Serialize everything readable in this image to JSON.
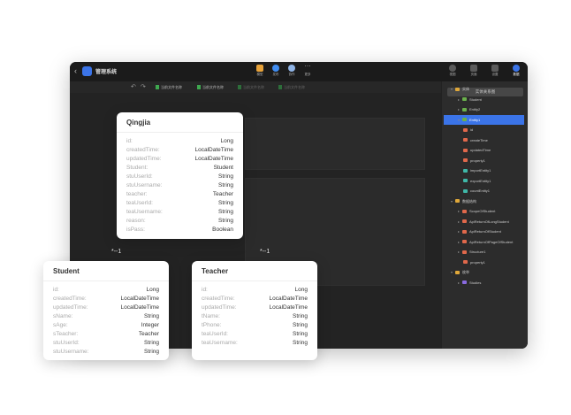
{
  "app": {
    "back": "‹",
    "title": "管理系统"
  },
  "toolbar": [
    {
      "label": "模型",
      "icon": "model-icon",
      "color": "#e8a33a"
    },
    {
      "label": "发布",
      "icon": "cloud-icon",
      "color": "#3f8cf0"
    },
    {
      "label": "协作",
      "icon": "collab-icon",
      "color": "#8fb4e6"
    },
    {
      "label": "更多",
      "icon": "more-icon",
      "color": "#9a9a9a"
    }
  ],
  "right_toolbar": [
    {
      "label": "视图",
      "icon": "view-icon"
    },
    {
      "label": "页面",
      "icon": "page-icon"
    },
    {
      "label": "设置",
      "icon": "settings-icon"
    },
    {
      "label": "数据",
      "icon": "data-icon"
    }
  ],
  "subbar": {
    "undo": "↶",
    "redo": "↷",
    "tabs": [
      "当前文件名称",
      "当前文件名称",
      "当前文件名称",
      "当前文件名称"
    ]
  },
  "right_panel": {
    "button": "实体关系图",
    "tree": [
      {
        "label": "实体",
        "icon": "folder-icon",
        "type": "folder",
        "expanded": true
      },
      {
        "label": "Student",
        "icon": "entity-icon",
        "type": "entity"
      },
      {
        "label": "Entity2",
        "icon": "entity-icon",
        "type": "entity"
      },
      {
        "label": "Entity1",
        "icon": "entity-icon",
        "type": "entity",
        "selected": true
      },
      {
        "label": "id",
        "icon": "field-icon",
        "type": "field"
      },
      {
        "label": "createTime",
        "icon": "field-icon",
        "type": "field"
      },
      {
        "label": "updatedTime",
        "icon": "field-icon",
        "type": "field"
      },
      {
        "label": "property1",
        "icon": "field-icon",
        "type": "field"
      },
      {
        "label": "importEntity1",
        "icon": "logic-icon",
        "type": "logic"
      },
      {
        "label": "exportEntity1",
        "icon": "logic-icon",
        "type": "logic"
      },
      {
        "label": "countEntity1",
        "icon": "logic-icon",
        "type": "logic"
      },
      {
        "label": "数据结构",
        "icon": "folder-icon",
        "type": "folder",
        "expanded": true
      },
      {
        "label": "ScopeOfStudent",
        "icon": "struct-icon",
        "type": "struct"
      },
      {
        "label": "ApiReturnOfLongStudent",
        "icon": "struct-icon",
        "type": "struct"
      },
      {
        "label": "ApiReturnOfStudent",
        "icon": "struct-icon",
        "type": "struct"
      },
      {
        "label": "ApiReturnOfPageOfStudent",
        "icon": "struct-icon",
        "type": "struct"
      },
      {
        "label": "Structure1",
        "icon": "struct-icon",
        "type": "struct"
      },
      {
        "label": "property1",
        "icon": "field-icon",
        "type": "field"
      },
      {
        "label": "枚举",
        "icon": "folder-icon",
        "type": "folder",
        "expanded": true
      },
      {
        "label": "Studies",
        "icon": "enum-icon",
        "type": "enum"
      }
    ]
  },
  "cards": {
    "qingjia": {
      "title": "Qingjia",
      "fields": [
        {
          "name": "id:",
          "type": "Long"
        },
        {
          "name": "createdTime:",
          "type": "LocalDateTime"
        },
        {
          "name": "updatedTime:",
          "type": "LocalDateTime"
        },
        {
          "name": "Student:",
          "type": "Student"
        },
        {
          "name": "stuUserId:",
          "type": "String"
        },
        {
          "name": "stuUsername:",
          "type": "String"
        },
        {
          "name": "teacher:",
          "type": "Teacher"
        },
        {
          "name": "teaUserId:",
          "type": "String"
        },
        {
          "name": "teaUsername:",
          "type": "String"
        },
        {
          "name": "reason:",
          "type": "String"
        },
        {
          "name": "isPass:",
          "type": "Boolean"
        }
      ]
    },
    "student": {
      "title": "Student",
      "fields": [
        {
          "name": "id:",
          "type": "Long"
        },
        {
          "name": "createdTime:",
          "type": "LocalDateTime"
        },
        {
          "name": "updatedTime:",
          "type": "LocalDateTime"
        },
        {
          "name": "sName:",
          "type": "String"
        },
        {
          "name": "sAge:",
          "type": "Integer"
        },
        {
          "name": "sTeacher:",
          "type": "Teacher"
        },
        {
          "name": "stuUserId:",
          "type": "String"
        },
        {
          "name": "stuUsername:",
          "type": "String"
        }
      ]
    },
    "teacher": {
      "title": "Teacher",
      "fields": [
        {
          "name": "id:",
          "type": "Long"
        },
        {
          "name": "createdTime:",
          "type": "LocalDateTime"
        },
        {
          "name": "updatedTime:",
          "type": "LocalDateTime"
        },
        {
          "name": "tName:",
          "type": "String"
        },
        {
          "name": "tPhone:",
          "type": "String"
        },
        {
          "name": "teaUserId:",
          "type": "String"
        },
        {
          "name": "teaUsername:",
          "type": "String"
        }
      ]
    }
  },
  "multiplicities": [
    "*--1",
    "*--1"
  ],
  "colors": {
    "accent": "#3b74e8",
    "canvas": "#232323",
    "panel": "#2c2c2c"
  }
}
